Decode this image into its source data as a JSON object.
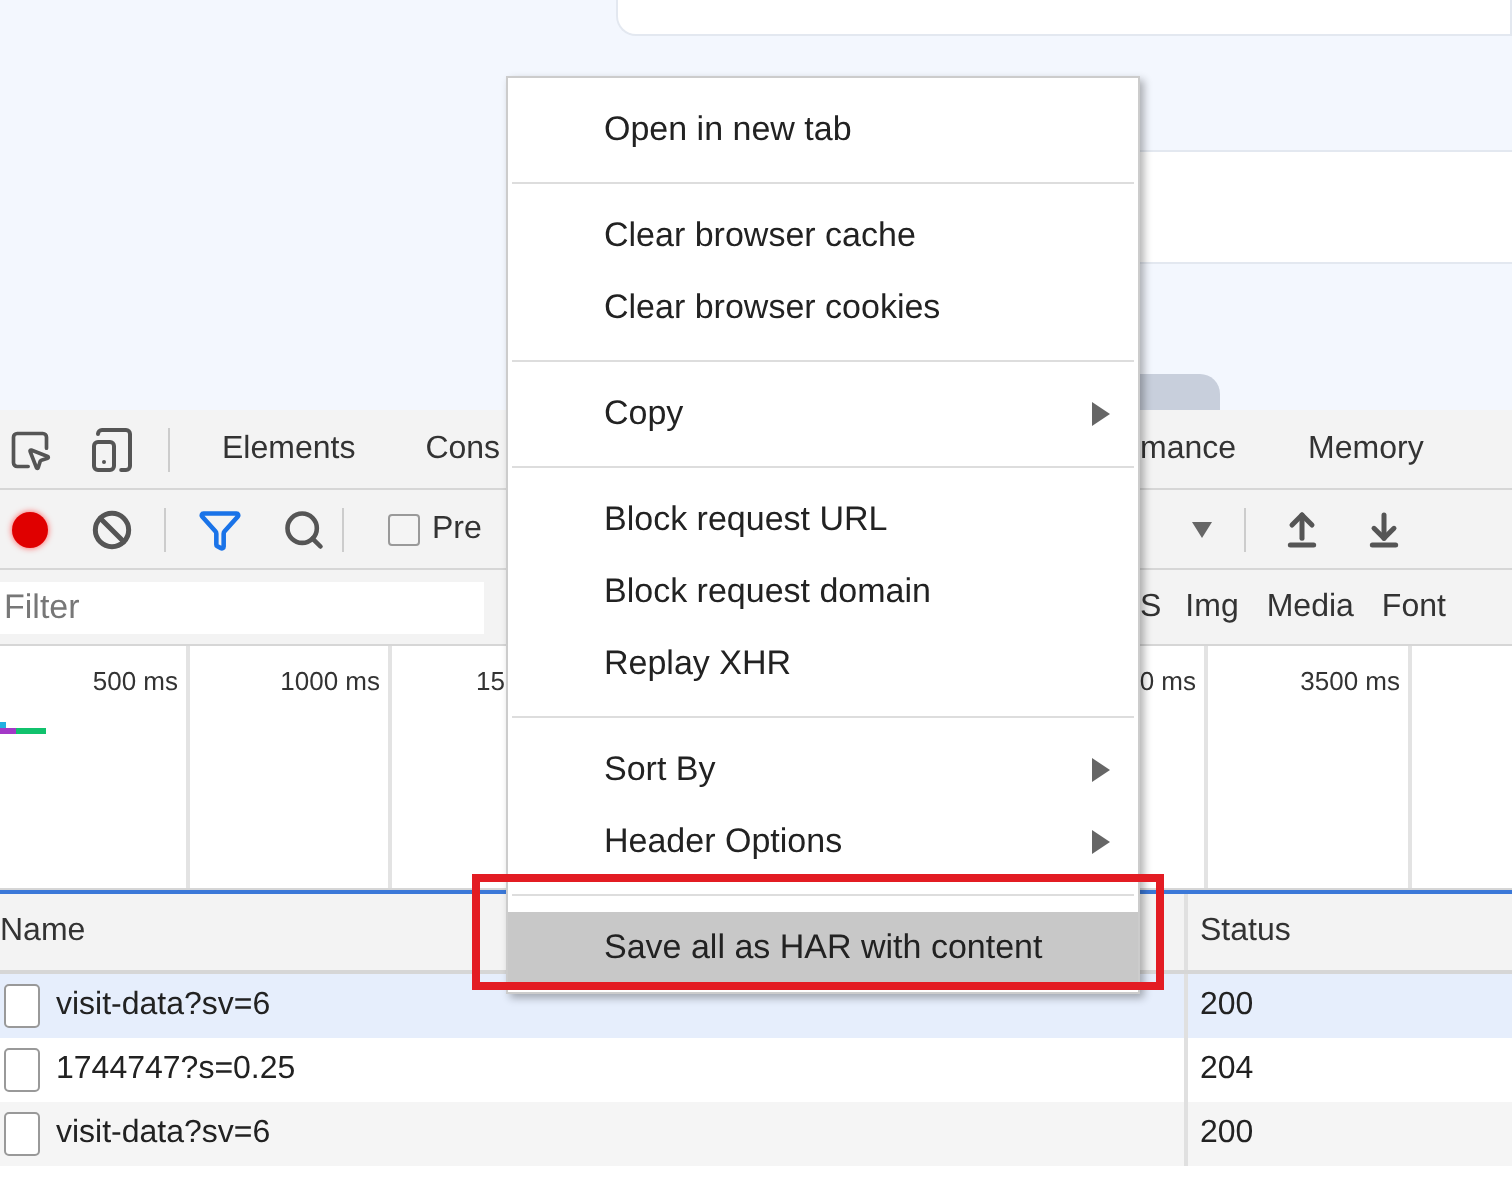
{
  "devtools": {
    "panel_tabs_left": [
      {
        "label": "Elements"
      },
      {
        "label": "Cons"
      }
    ],
    "panel_tabs_right": [
      {
        "label": "mance"
      },
      {
        "label": "Memory"
      }
    ],
    "toolbar": {
      "recording": true,
      "filter_active": true,
      "preserve_checkbox": {
        "label": "Pre",
        "checked": false
      }
    },
    "filter": {
      "placeholder": "Filter"
    },
    "type_filters": [
      "S",
      "Img",
      "Media",
      "Font"
    ],
    "timeline": {
      "left_labels": [
        "500 ms",
        "1000 ms",
        "15"
      ],
      "right_labels": [
        "0 ms",
        "3500 ms"
      ]
    },
    "table": {
      "columns": [
        "Name",
        "Status"
      ],
      "rows": [
        {
          "name": "visit-data?sv=6",
          "status": "200",
          "selected": true
        },
        {
          "name": "1744747?s=0.25",
          "status": "204",
          "selected": false
        },
        {
          "name": "visit-data?sv=6",
          "status": "200",
          "selected": false
        }
      ]
    }
  },
  "context_menu": {
    "groups": [
      [
        {
          "label": "Open in new tab",
          "submenu": false,
          "selected": false
        }
      ],
      [
        {
          "label": "Clear browser cache",
          "submenu": false,
          "selected": false
        },
        {
          "label": "Clear browser cookies",
          "submenu": false,
          "selected": false
        }
      ],
      [
        {
          "label": "Copy",
          "submenu": true,
          "selected": false
        }
      ],
      [
        {
          "label": "Block request URL",
          "submenu": false,
          "selected": false
        },
        {
          "label": "Block request domain",
          "submenu": false,
          "selected": false
        },
        {
          "label": "Replay XHR",
          "submenu": false,
          "selected": false
        }
      ],
      [
        {
          "label": "Sort By",
          "submenu": true,
          "selected": false
        },
        {
          "label": "Header Options",
          "submenu": true,
          "selected": false
        }
      ],
      [
        {
          "label": "Save all as HAR with content",
          "submenu": false,
          "selected": true
        }
      ]
    ]
  }
}
